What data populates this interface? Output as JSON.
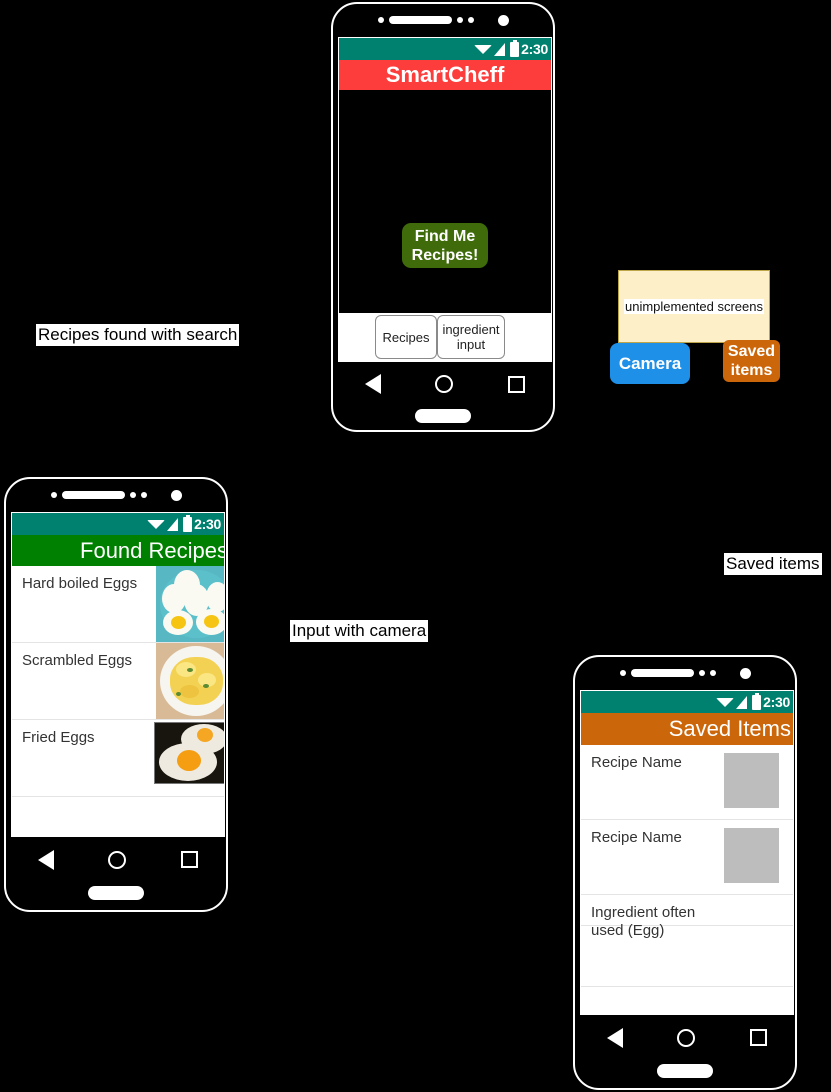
{
  "annotations": [
    {
      "id": "recipes-found-with-search",
      "text": "Recipes found with search"
    },
    {
      "id": "input-with-camera",
      "text": "Input with camera"
    },
    {
      "id": "saved-items",
      "text": "Saved items"
    }
  ],
  "sticky_note": {
    "text": "unimplemented screens",
    "background": "#fdefc8",
    "border": "#bfa54a"
  },
  "unimplemented_buttons": [
    {
      "label": "Camera",
      "color": "#1e90e8"
    },
    {
      "label": "Saved\nitems",
      "line1": "Saved",
      "line2": "items",
      "color": "#cc660a"
    }
  ],
  "status_bar": {
    "time": "2:30",
    "background": "#00806e",
    "icons": [
      "wifi-icon",
      "signal-icon",
      "battery-icon"
    ]
  },
  "screens": {
    "main": {
      "app_title": "SmartCheff",
      "app_bar_color": "#fd3c3c",
      "primary_button": {
        "line1": "Find Me",
        "line2": "Recipes!",
        "color": "#3f6b0b"
      },
      "tabs": [
        {
          "label": "Recipes"
        },
        {
          "line1": "ingredient",
          "line2": "input"
        }
      ]
    },
    "found_recipes": {
      "app_title": "Found Recipes",
      "app_bar_color": "#008000",
      "rows": [
        {
          "label": "Hard boiled Eggs",
          "image": "hard-boiled-eggs-photo"
        },
        {
          "label": "Scrambled Eggs",
          "image": "scrambled-eggs-photo"
        },
        {
          "label": "Fried Eggs",
          "image": "fried-eggs-photo"
        }
      ]
    },
    "saved_items": {
      "app_title": "Saved Items",
      "app_bar_color": "#cc660a",
      "rows": [
        {
          "label": "Recipe Name",
          "image": "placeholder-thumb"
        },
        {
          "label": "Recipe Name",
          "image": "placeholder-thumb"
        },
        {
          "line1": "Ingredient often",
          "line2": "used (Egg)",
          "image": null
        }
      ]
    }
  }
}
